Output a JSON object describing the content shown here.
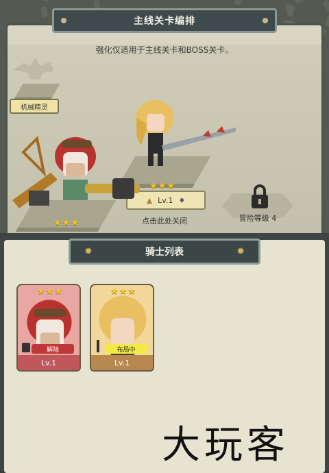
{
  "header": {
    "title": "主线关卡编排"
  },
  "subtitle": "强化仅适用于主线关卡和BOSS关卡。",
  "slots": {
    "left_label": "机械精灵",
    "center_level": "Lv.1",
    "stars": "★★★",
    "close_hint": "点击此处关闭",
    "locked_label": "冒险等级 4"
  },
  "knight_list": {
    "title": "骑士列表",
    "cards": [
      {
        "stars": "★★★",
        "tag": "解除",
        "level": "Lv.1",
        "color": "#c0575a"
      },
      {
        "stars": "★★★",
        "tag": "布局中",
        "level": "Lv.1",
        "color": "#b7894e"
      }
    ]
  },
  "watermark": "大玩客",
  "colors": {
    "accent": "#f3c42a",
    "panel": "#d8d6c2",
    "frame": "#3f4a4c"
  }
}
